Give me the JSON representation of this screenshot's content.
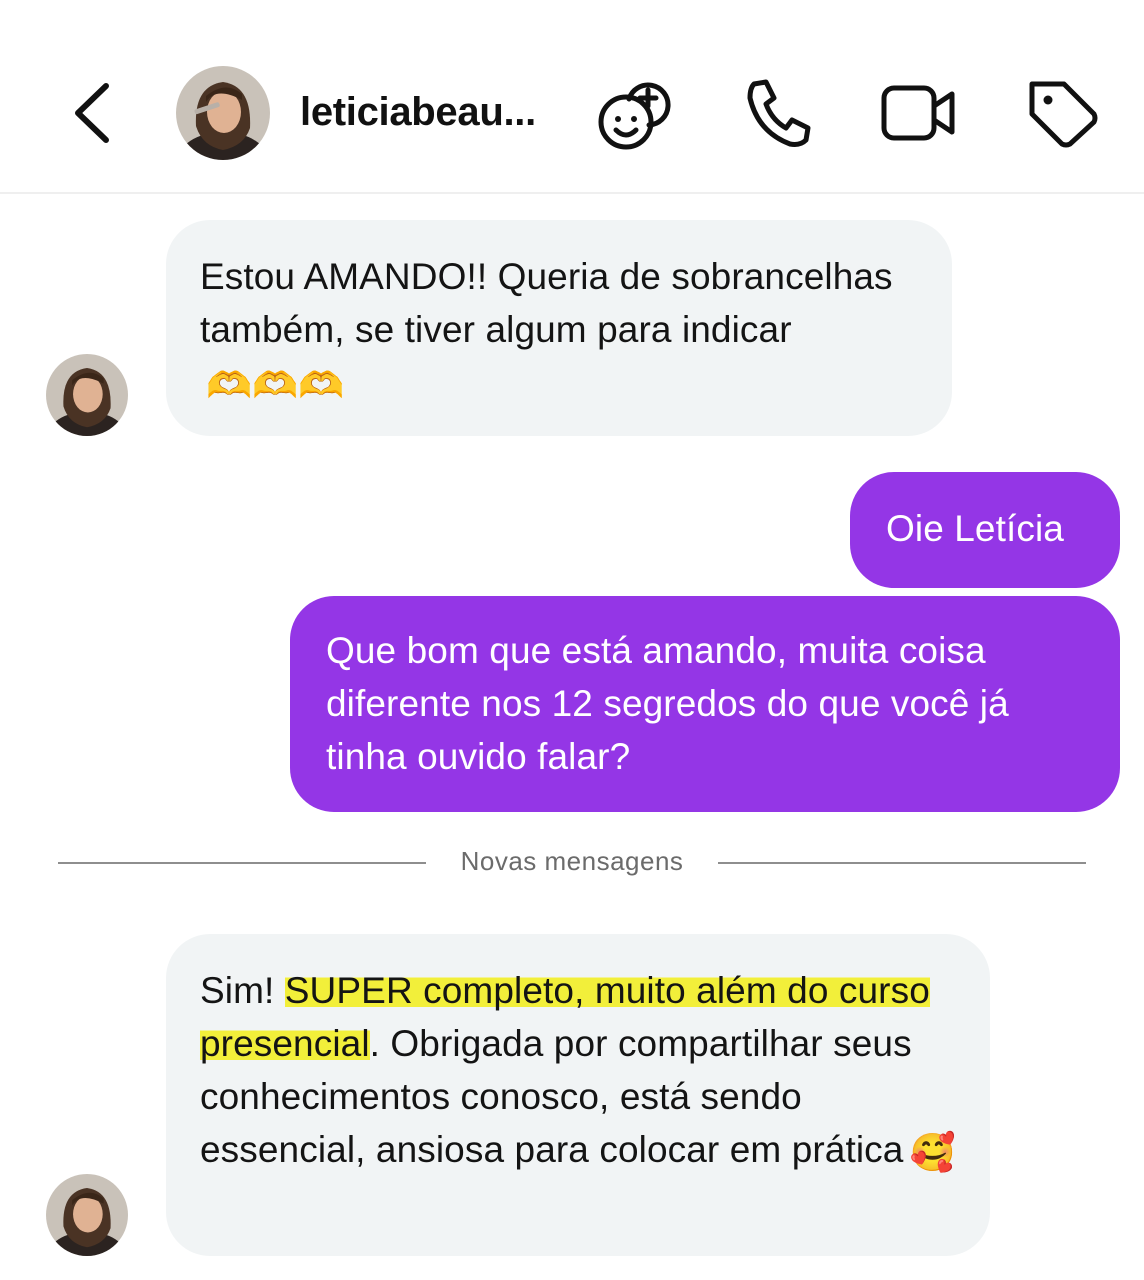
{
  "header": {
    "username": "leticiabeau...",
    "icons": [
      "back-icon",
      "effects-icon",
      "phone-icon",
      "video-icon",
      "tag-icon"
    ]
  },
  "messages": [
    {
      "side": "in",
      "text": "Estou AMANDO!! Queria de sobrancelhas também, se tiver algum para indicar",
      "emoji": "🫶🫶🫶"
    },
    {
      "side": "out",
      "text": "Oie Letícia"
    },
    {
      "side": "out",
      "text": "Que bom que está amando, muita coisa diferente nos 12 segredos do que você já tinha ouvido falar?"
    },
    {
      "side": "in",
      "text_before": "Sim! ",
      "text_highlight": "SUPER completo, muito além do curso presencial",
      "text_after": ". Obrigada por compartilhar seus conhecimentos conosco, está sendo essencial, ansiosa para colocar em prática",
      "emoji": "🥰"
    }
  ],
  "divider_label": "Novas mensagens",
  "colors": {
    "outgoing": "#9436e6",
    "incoming": "#f1f4f5",
    "highlight": "#f2ef3a"
  }
}
